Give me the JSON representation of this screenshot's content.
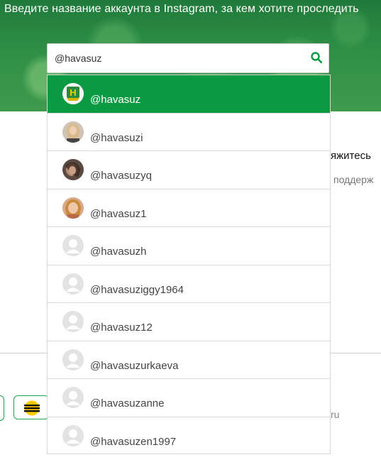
{
  "hero": {
    "title": "Введите название аккаунта в Instagram, за кем хотите проследить"
  },
  "search": {
    "value": "@havasuz",
    "icon": "search-icon"
  },
  "suggestions": [
    {
      "handle": "@havasuz",
      "avatar": "brand-logo",
      "active": true
    },
    {
      "handle": "@havasuzi",
      "avatar": "photo"
    },
    {
      "handle": "@havasuzyq",
      "avatar": "photo"
    },
    {
      "handle": "@havasuz1",
      "avatar": "photo"
    },
    {
      "handle": "@havasuzh",
      "avatar": "default-avatar"
    },
    {
      "handle": "@havasuziggy1964",
      "avatar": "default-avatar"
    },
    {
      "handle": "@havasuz12",
      "avatar": "default-avatar"
    },
    {
      "handle": "@havasuzurkaeva",
      "avatar": "default-avatar"
    },
    {
      "handle": "@havasuzanne",
      "avatar": "default-avatar"
    },
    {
      "handle": "@havasuzen1997",
      "avatar": "default-avatar"
    }
  ],
  "background_fragments": {
    "right_1": "яжитесь",
    "right_2": "поддерж",
    "right_3": "ru"
  },
  "colors": {
    "accent": "#0a9a42",
    "hero_green": "#2e8f45",
    "pill_border": "#18a84a"
  }
}
